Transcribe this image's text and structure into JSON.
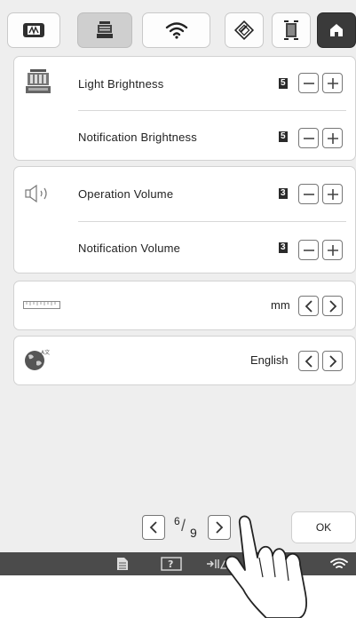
{
  "tabs": [
    {
      "name": "embroidery-frame-icon"
    },
    {
      "name": "machine-icon",
      "selected": true
    },
    {
      "name": "wifi-icon"
    },
    {
      "name": "edit-icon"
    },
    {
      "name": "frame-icon"
    },
    {
      "name": "home-icon",
      "active": true
    }
  ],
  "settings": {
    "light_brightness": {
      "label": "Light Brightness",
      "value": "5"
    },
    "notification_brightness": {
      "label": "Notification Brightness",
      "value": "5"
    },
    "operation_volume": {
      "label": "Operation Volume",
      "value": "3"
    },
    "notification_volume": {
      "label": "Notification Volume",
      "value": "3"
    },
    "units": {
      "value": "mm"
    },
    "language": {
      "value": "English"
    }
  },
  "pager": {
    "current": "6",
    "total": "9"
  },
  "ok_label": "OK",
  "colors": {
    "background": "#eeeeee",
    "panel": "#ffffff",
    "statusbar": "#4b4b4b",
    "active_tab": "#3a3a3a"
  }
}
